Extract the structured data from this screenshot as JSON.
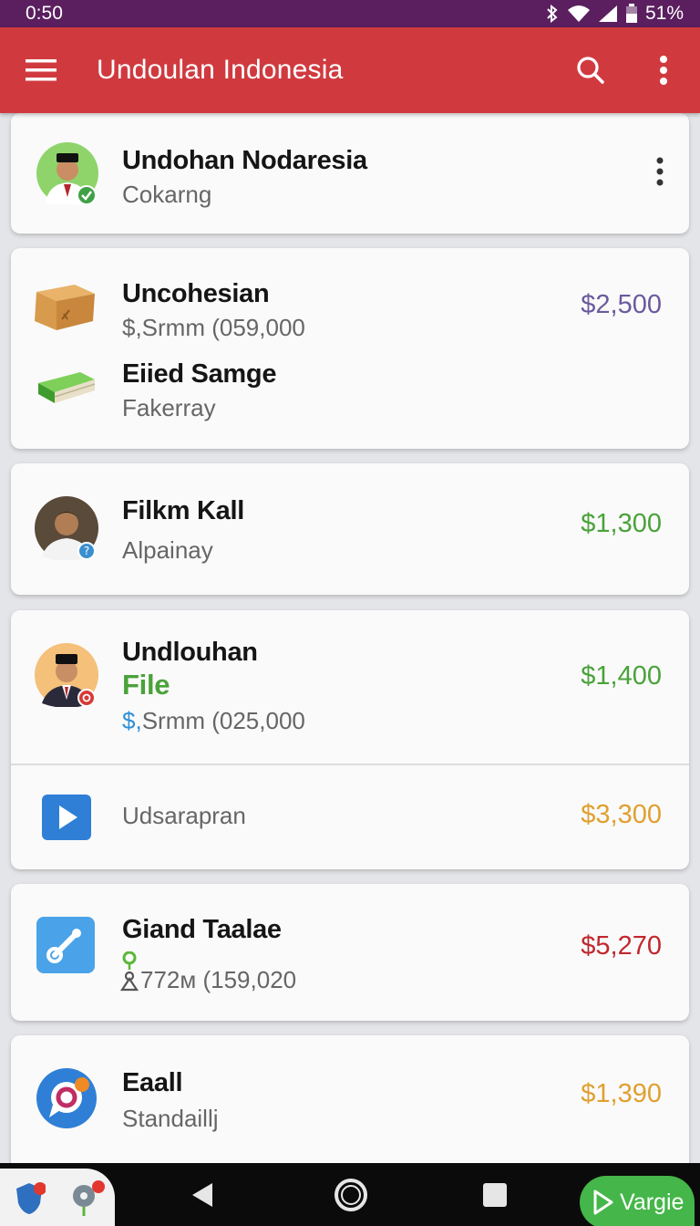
{
  "status_bar": {
    "time": "0:50",
    "battery": "51%"
  },
  "app_bar": {
    "title": "Undoulan Indonesia"
  },
  "items": [
    {
      "title": "Undohan Nodaresia",
      "subtitle": "Cokarng",
      "icon": "person-avatar-green"
    },
    {
      "title": "Uncohesian",
      "subtitle": "$,Srmm (059,000",
      "amount": "$2,500",
      "amount_color": "#6b5a9e",
      "icon": "package-box-icon"
    },
    {
      "title": "Eiied Samge",
      "subtitle": "Fakerray",
      "icon": "green-book-icon"
    },
    {
      "title": "Filkm Kall",
      "subtitle": "Alpainay",
      "amount": "$1,300",
      "amount_color": "#4aa23a",
      "icon": "person-avatar"
    },
    {
      "title": "Undlouhan",
      "title_extra": "File",
      "subtitle_prefix": "$,",
      "subtitle": "Srmm (025,000",
      "amount": "$1,400",
      "amount_color": "#4aa23a",
      "icon": "person-avatar-orange"
    },
    {
      "subtitle": "Udsarapran",
      "amount": "$3,300",
      "amount_color": "#e0a030",
      "icon": "play-icon"
    },
    {
      "title": "Giand Taalae",
      "subtitle": "772м (159,020",
      "amount": "$5,270",
      "amount_color": "#c0282e",
      "icon": "wrench-icon"
    },
    {
      "title": "Eaall",
      "subtitle": "Standaillj",
      "amount": "$1,390",
      "amount_color": "#e0a030",
      "icon": "chat-bubble-icon"
    }
  ],
  "nav": {
    "cta_label": "Vargie"
  },
  "colors": {
    "app_bar": "#d03a3f",
    "status_bar": "#5b1f5f",
    "cta": "#45b649"
  }
}
